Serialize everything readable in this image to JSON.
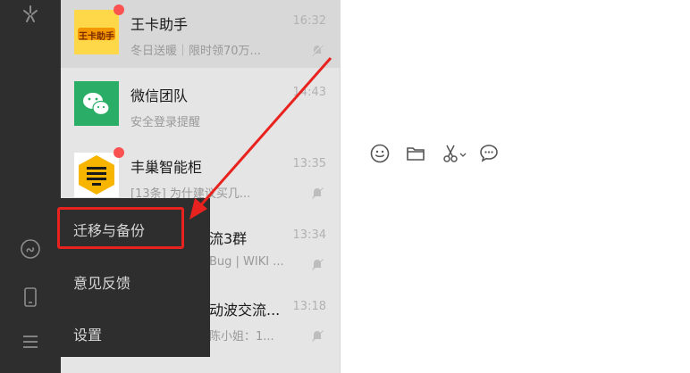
{
  "colors": {
    "rail": "#2e2e2e",
    "list_bg": "#e6e5e5",
    "unread_dot": "#fa5151",
    "highlight": "#e8231f"
  },
  "chats": [
    {
      "name": "王卡助手",
      "time": "16:32",
      "preview": "冬日送暖｜限时领70万...",
      "unread": true,
      "muted": true,
      "avatar": "wangka-logo"
    },
    {
      "name": "微信团队",
      "time": "14:43",
      "preview": "安全登录提醒",
      "unread": false,
      "muted": false,
      "avatar": "wechat-logo"
    },
    {
      "name": "丰巢智能柜",
      "time": "13:35",
      "preview": "[13条] 为什建议买几...",
      "unread": true,
      "muted": true,
      "avatar": "hive-box-logo"
    },
    {
      "name": "流3群",
      "time": "13:34",
      "preview": "Bug | WIKI ...",
      "unread": false,
      "muted": true
    },
    {
      "name": "动波交流...",
      "time": "13:18",
      "preview": "陈小姐：1...",
      "unread": false,
      "muted": true
    }
  ],
  "wangka_badge": "王卡助手",
  "menu": {
    "items": [
      "迁移与备份",
      "意见反馈",
      "设置"
    ]
  },
  "rail_icons": [
    "mini-program-icon",
    "phone-icon",
    "menu-icon",
    "moments-icon"
  ],
  "toolbar_icons": [
    "emoji-icon",
    "folder-icon",
    "screenshot-icon",
    "chat-history-icon"
  ]
}
